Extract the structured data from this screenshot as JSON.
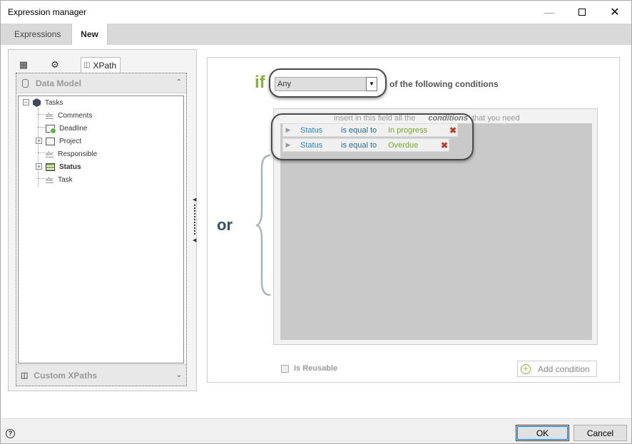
{
  "window": {
    "title": "Expression manager"
  },
  "tabs": [
    {
      "label": "Expressions"
    },
    {
      "label": "New"
    }
  ],
  "left_panel": {
    "xpath_tab": "XPath",
    "data_model_header": "Data Model",
    "custom_xpaths_header": "Custom XPaths",
    "tree": {
      "root": "Tasks",
      "children": [
        {
          "label": "Comments",
          "icon": "abc-text-icon"
        },
        {
          "label": "Deadline",
          "icon": "date-field-icon"
        },
        {
          "label": "Project",
          "icon": "entity-icon",
          "expandable": true
        },
        {
          "label": "Responsible",
          "icon": "abc-text-icon"
        },
        {
          "label": "Status",
          "icon": "table-entity-icon",
          "expandable": true,
          "bold": true
        },
        {
          "label": "Task",
          "icon": "abc-text-icon"
        }
      ]
    }
  },
  "condition_builder": {
    "if_label": "if",
    "quantifier": "Any",
    "following_text": "of the following conditions",
    "hint_prefix": "insert in this field all the",
    "hint_emphasis": "conditions",
    "hint_suffix": "that you need",
    "or_label": "or",
    "conditions": [
      {
        "field": "Status",
        "operator": "is equal to",
        "value": "In progress"
      },
      {
        "field": "Status",
        "operator": "is equal to",
        "value": "Overdue"
      }
    ],
    "is_reusable_label": "Is Reusable",
    "add_condition_label": "Add condition"
  },
  "footer": {
    "ok_label": "OK",
    "cancel_label": "Cancel"
  }
}
